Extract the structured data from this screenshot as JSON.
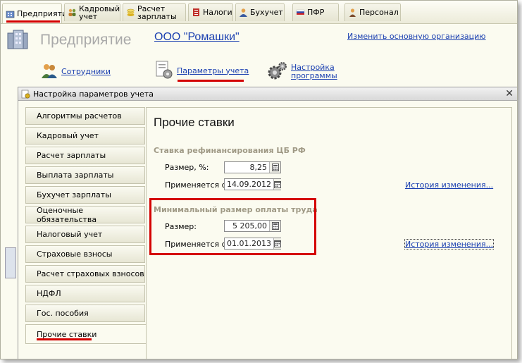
{
  "tabs": [
    {
      "label": "Предприятие",
      "icon": "building-icon",
      "active": true
    },
    {
      "label": "Кадровый\nучет",
      "icon": "people-icon"
    },
    {
      "label": "Расчет\nзарплаты",
      "icon": "coins-icon"
    },
    {
      "label": "Налоги",
      "icon": "tax-document-icon"
    },
    {
      "label": "Бухучет",
      "icon": "accountant-icon"
    },
    {
      "label": "ПФР",
      "icon": "pfr-flag-icon"
    },
    {
      "label": "Персонал",
      "icon": "person-icon"
    }
  ],
  "header": {
    "title": "Предприятие",
    "organization": "ООО \"Ромашки\"",
    "change_org": "Изменить основную организацию"
  },
  "nav": {
    "employees": "Сотрудники",
    "accounting_params": "Параметры учета",
    "program_settings": "Настройка\nпрограммы"
  },
  "dialog": {
    "title": "Настройка параметров учета",
    "close": "✕",
    "sections": [
      "Алгоритмы расчетов",
      "Кадровый учет",
      "Расчет зарплаты",
      "Выплата зарплаты",
      "Бухучет зарплаты",
      "Оценочные обязательства",
      "Налоговый учет",
      "Страховые взносы",
      "Расчет страховых взносов",
      "НДФЛ",
      "Гос. пособия",
      "Прочие ставки"
    ],
    "selected_index": 11
  },
  "content": {
    "title": "Прочие ставки",
    "refinancing": {
      "heading": "Ставка рефинансирования ЦБ РФ",
      "size_label": "Размер, %:",
      "size_value": "8,25",
      "date_label": "Применяется с:",
      "date_value": "14.09.2012",
      "history": "История изменения..."
    },
    "min_wage": {
      "heading": "Минимальный размер оплаты труда",
      "size_label": "Размер:",
      "size_value": "5 205,00",
      "date_label": "Применяется с:",
      "date_value": "01.01.2013",
      "history": "История изменения..."
    }
  },
  "colors": {
    "highlight": "#d40000",
    "link": "#1a3fb0"
  }
}
